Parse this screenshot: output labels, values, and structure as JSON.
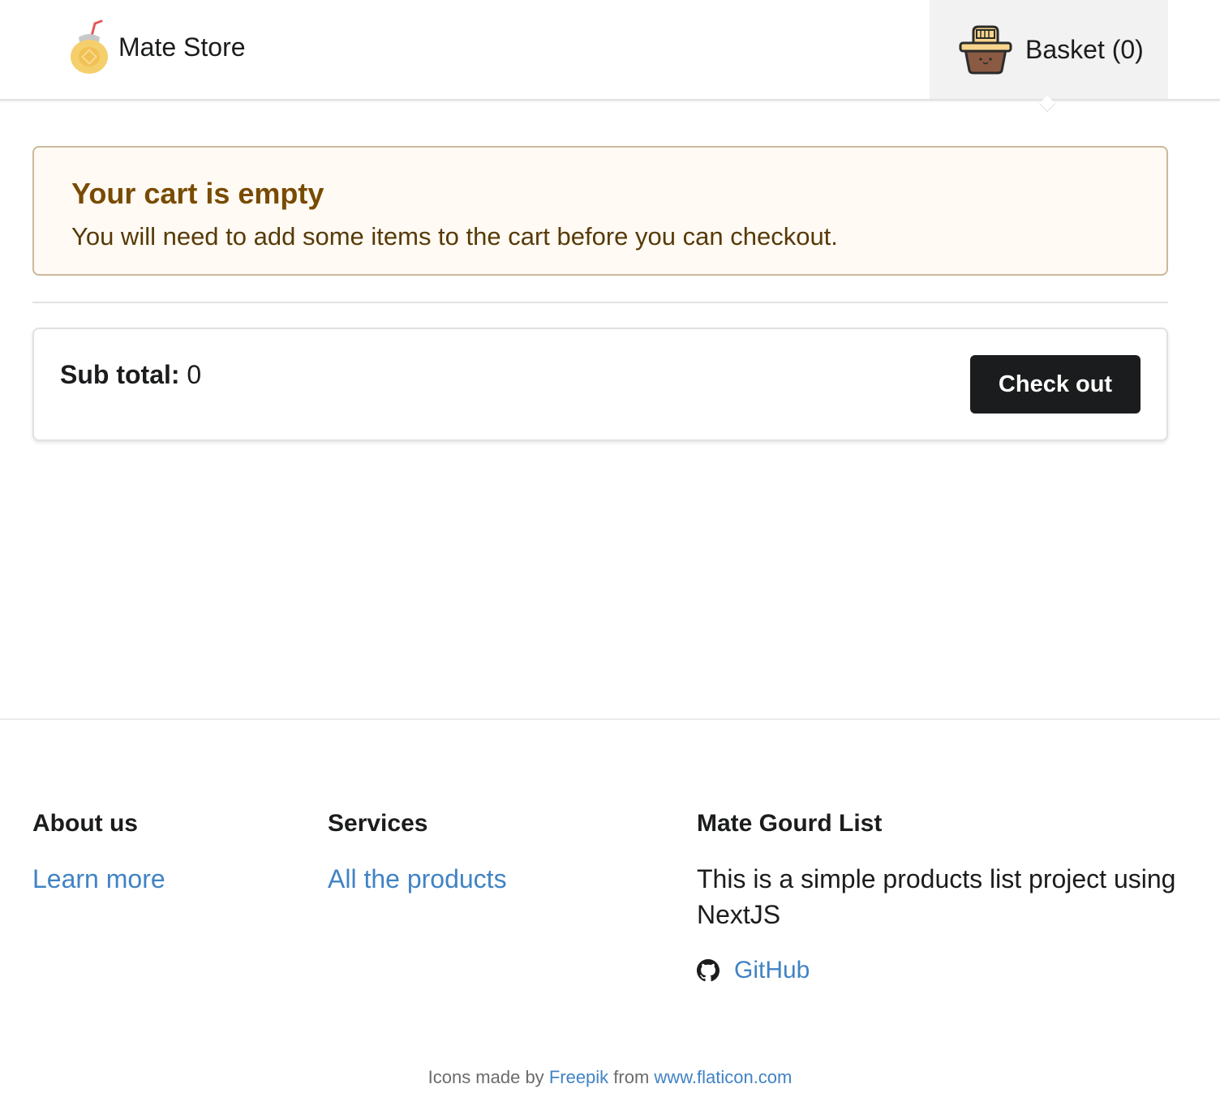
{
  "header": {
    "brand_name": "Mate Store",
    "basket_label": "Basket (0)"
  },
  "cart_message": {
    "title": "Your cart is empty",
    "text": "You will need to add some items to the cart before you can checkout."
  },
  "summary": {
    "subtotal_label": "Sub total:",
    "subtotal_value": "0",
    "checkout_label": "Check out"
  },
  "footer": {
    "about": {
      "heading": "About us",
      "link": "Learn more"
    },
    "services": {
      "heading": "Services",
      "link": "All the products"
    },
    "mate": {
      "heading": "Mate Gourd List",
      "description": "This is a simple products list project using NextJS",
      "github_label": "GitHub"
    },
    "credits": {
      "prefix": "Icons made by",
      "author": "Freepik",
      "middle": "from",
      "site": "www.flaticon.com"
    }
  },
  "colors": {
    "message_bg": "#fffaf3",
    "message_title": "#794b02",
    "message_text": "#573a08",
    "button_bg": "#1b1c1d",
    "link": "#4183c4"
  },
  "icons": {
    "brand": "mate-gourd-icon",
    "basket": "basket-icon",
    "github": "github-icon"
  }
}
